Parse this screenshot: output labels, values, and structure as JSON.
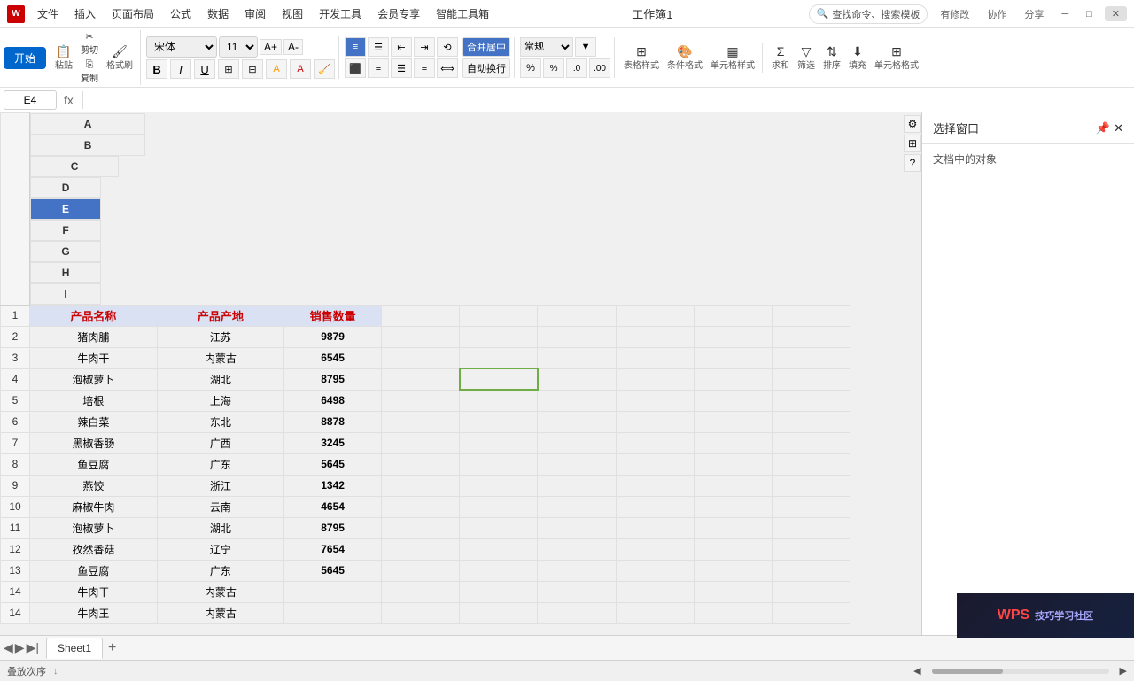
{
  "titleBar": {
    "appName": "WPS",
    "fileName": "工作簿1",
    "menus": [
      "文件",
      "插入",
      "页面布局",
      "公式",
      "数据",
      "审阅",
      "视图",
      "开发工具",
      "会员专享",
      "智能工具箱"
    ],
    "searchPlaceholder": "查找命令、搜索模板",
    "rightBtns": [
      "有修改",
      "协作",
      "分享"
    ],
    "windowBtns": [
      "─",
      "□",
      "✕"
    ]
  },
  "toolbar": {
    "pasteLabel": "粘贴",
    "cutLabel": "剪切",
    "copyLabel": "复制",
    "formatLabel": "格式刷",
    "fontName": "宋体",
    "fontSize": "11",
    "boldLabel": "B",
    "italicLabel": "I",
    "underlineLabel": "U",
    "startBtnLabel": "开始",
    "alignLeft": "左对齐",
    "alignCenter": "居中",
    "alignRight": "右对齐",
    "mergeCellLabel": "合并居中",
    "wrapLabel": "自动换行",
    "condFormatLabel": "条件格式",
    "cellStyleLabel": "单元格样式",
    "tableStyleLabel": "表格样式",
    "cellFormatLabel": "单元格格式",
    "sortLabel": "排序",
    "filterLabel": "筛选",
    "fillLabel": "填充",
    "sumLabel": "求和"
  },
  "formulaBar": {
    "cellRef": "E4",
    "fxLabel": "fx"
  },
  "columns": [
    {
      "label": "A",
      "id": "A"
    },
    {
      "label": "B",
      "id": "B"
    },
    {
      "label": "C",
      "id": "C"
    },
    {
      "label": "D",
      "id": "D"
    },
    {
      "label": "E",
      "id": "E"
    },
    {
      "label": "F",
      "id": "F"
    },
    {
      "label": "G",
      "id": "G"
    },
    {
      "label": "H",
      "id": "H"
    },
    {
      "label": "I",
      "id": "I"
    }
  ],
  "tableData": {
    "headers": [
      "产品名称",
      "产品产地",
      "销售数量"
    ],
    "rows": [
      {
        "id": 2,
        "col1": "猪肉脯",
        "col2": "江苏",
        "col3": "9879"
      },
      {
        "id": 3,
        "col1": "牛肉干",
        "col2": "内蒙古",
        "col3": "6545"
      },
      {
        "id": 4,
        "col1": "泡椒萝卜",
        "col2": "湖北",
        "col3": "8795"
      },
      {
        "id": 5,
        "col1": "培根",
        "col2": "上海",
        "col3": "6498"
      },
      {
        "id": 6,
        "col1": "辣白菜",
        "col2": "东北",
        "col3": "8878"
      },
      {
        "id": 7,
        "col1": "黑椒香肠",
        "col2": "广西",
        "col3": "3245"
      },
      {
        "id": 8,
        "col1": "鱼豆腐",
        "col2": "广东",
        "col3": "5645"
      },
      {
        "id": 9,
        "col1": "燕饺",
        "col2": "浙江",
        "col3": "1342"
      },
      {
        "id": 10,
        "col1": "麻椒牛肉",
        "col2": "云南",
        "col3": "4654"
      },
      {
        "id": 11,
        "col1": "泡椒萝卜",
        "col2": "湖北",
        "col3": "8795"
      },
      {
        "id": 12,
        "col1": "孜然香菇",
        "col2": "辽宁",
        "col3": "7654"
      },
      {
        "id": 13,
        "col1": "鱼豆腐",
        "col2": "广东",
        "col3": "5645"
      },
      {
        "id": 14,
        "col1": "牛肉干",
        "col2": "内蒙古",
        "col3": ""
      }
    ]
  },
  "rightPanel": {
    "title": "选择窗口",
    "subtitle": "文档中的对象",
    "pinIcon": "📌",
    "closeIcon": "✕"
  },
  "sheetTabs": {
    "tabs": [
      "Sheet1"
    ],
    "addBtn": "+"
  },
  "statusBar": {
    "leftText": "叠放次序",
    "rightItems": [
      "WPS 技巧学习社区"
    ]
  },
  "wpsBanner": {
    "redText": "WPS",
    "text": "技巧学习社区"
  },
  "colors": {
    "headerBg": "#d9e1f2",
    "headerText": "#cc0000",
    "selectedColBg": "#4472c4",
    "activeCellBorder": "#70ad47",
    "startBtnBg": "#0066cc"
  }
}
